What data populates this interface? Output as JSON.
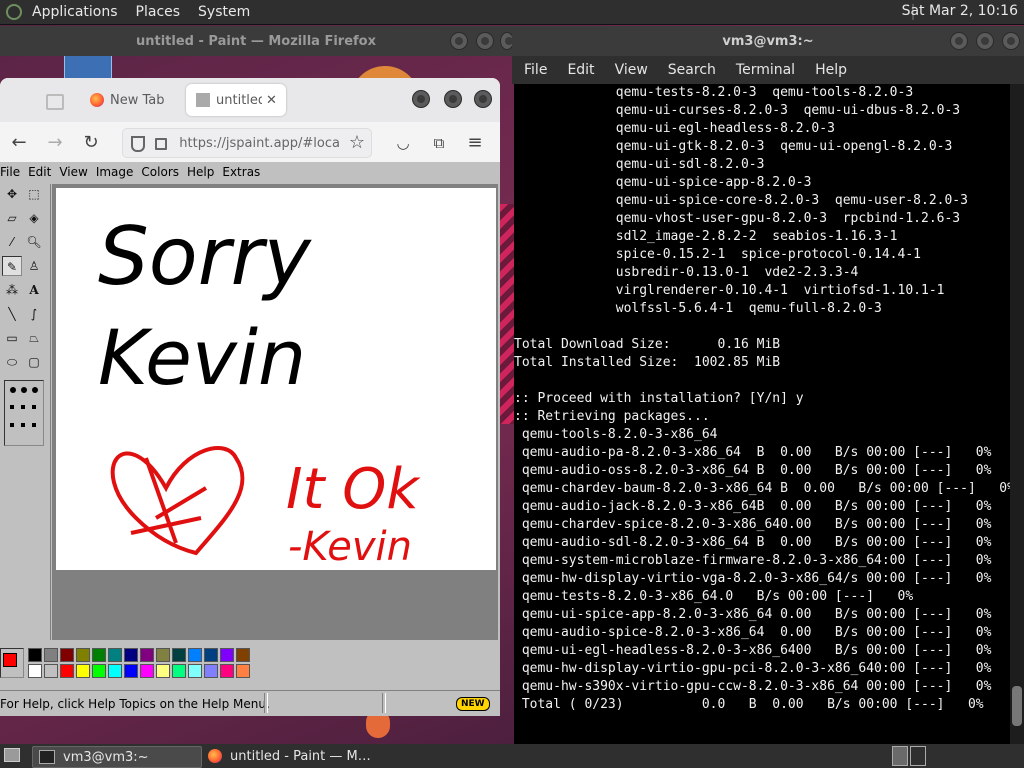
{
  "top_panel": {
    "menus": [
      "Applications",
      "Places",
      "System"
    ],
    "clock": "Sat Mar  2, 10:16"
  },
  "firefox": {
    "window_title": "untitled - Paint — Mozilla Firefox",
    "tabs": [
      {
        "label": "New Tab"
      },
      {
        "label": "untitled"
      }
    ],
    "url": "https://jspaint.app/#loca"
  },
  "paint": {
    "menu": [
      "File",
      "Edit",
      "View",
      "Image",
      "Colors",
      "Help",
      "Extras"
    ],
    "status_text": "For Help, click Help Topics on the Help Menu.",
    "new_badge": "NEW",
    "canvas_text": {
      "line1": "Sorry",
      "line2": "Kevin",
      "line3": "It Ok",
      "line4": "-Kevin"
    },
    "primary_color": "#ff0000",
    "secondary_color": "#ffffff",
    "palette_colors": [
      "#000000",
      "#808080",
      "#800000",
      "#808000",
      "#008000",
      "#008080",
      "#000080",
      "#800080",
      "#808040",
      "#004040",
      "#0080ff",
      "#004080",
      "#8000ff",
      "#804000",
      "#ffffff",
      "#c0c0c0",
      "#ff0000",
      "#ffff00",
      "#00ff00",
      "#00ffff",
      "#0000ff",
      "#ff00ff",
      "#ffff80",
      "#00ff80",
      "#80ffff",
      "#8080ff",
      "#ff0080",
      "#ff8040"
    ]
  },
  "terminal": {
    "window_title": "vm3@vm3:~",
    "menu": [
      "File",
      "Edit",
      "View",
      "Search",
      "Terminal",
      "Help"
    ],
    "lines": [
      "             qemu-tests-8.2.0-3  qemu-tools-8.2.0-3",
      "             qemu-ui-curses-8.2.0-3  qemu-ui-dbus-8.2.0-3",
      "             qemu-ui-egl-headless-8.2.0-3",
      "             qemu-ui-gtk-8.2.0-3  qemu-ui-opengl-8.2.0-3",
      "             qemu-ui-sdl-8.2.0-3",
      "             qemu-ui-spice-app-8.2.0-3",
      "             qemu-ui-spice-core-8.2.0-3  qemu-user-8.2.0-3",
      "             qemu-vhost-user-gpu-8.2.0-3  rpcbind-1.2.6-3",
      "             sdl2_image-2.8.2-2  seabios-1.16.3-1",
      "             spice-0.15.2-1  spice-protocol-0.14.4-1",
      "             usbredir-0.13.0-1  vde2-2.3.3-4",
      "             virglrenderer-0.10.4-1  virtiofsd-1.10.1-1",
      "             wolfssl-5.6.4-1  qemu-full-8.2.0-3",
      "",
      "Total Download Size:      0.16 MiB",
      "Total Installed Size:  1002.85 MiB",
      "",
      ":: Proceed with installation? [Y/n] y",
      ":: Retrieving packages...",
      " qemu-tools-8.2.0-3-x86_64",
      " qemu-audio-pa-8.2.0-3-x86_64  B  0.00   B/s 00:00 [---]   0%",
      " qemu-audio-oss-8.2.0-3-x86_64 B  0.00   B/s 00:00 [---]   0%",
      " qemu-chardev-baum-8.2.0-3-x86_64 B  0.00   B/s 00:00 [---]   0%",
      " qemu-audio-jack-8.2.0-3-x86_64B  0.00   B/s 00:00 [---]   0%",
      " qemu-chardev-spice-8.2.0-3-x86_640.00   B/s 00:00 [---]   0%",
      " qemu-audio-sdl-8.2.0-3-x86_64 B  0.00   B/s 00:00 [---]   0%",
      " qemu-system-microblaze-firmware-8.2.0-3-x86_64:00 [---]   0%",
      " qemu-hw-display-virtio-vga-8.2.0-3-x86_64/s 00:00 [---]   0%",
      " qemu-tests-8.2.0-3-x86_64.0   B/s 00:00 [---]   0%",
      " qemu-ui-spice-app-8.2.0-3-x86_64 0.00   B/s 00:00 [---]   0%",
      " qemu-audio-spice-8.2.0-3-x86_64  0.00   B/s 00:00 [---]   0%",
      " qemu-ui-egl-headless-8.2.0-3-x86_6400   B/s 00:00 [---]   0%",
      " qemu-hw-display-virtio-gpu-pci-8.2.0-3-x86_640:00 [---]   0%",
      " qemu-hw-s390x-virtio-gpu-ccw-8.2.0-3-x86_64 00:00 [---]   0%",
      " Total ( 0/23)          0.0   B  0.00   B/s 00:00 [---]   0%"
    ]
  },
  "taskbar": {
    "tasks": [
      {
        "label": "vm3@vm3:~"
      },
      {
        "label": "untitled - Paint — M…"
      }
    ]
  }
}
